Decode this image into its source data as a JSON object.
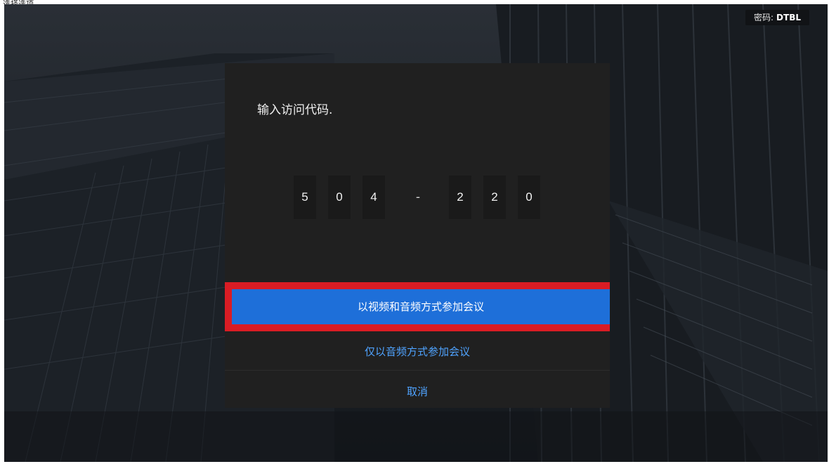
{
  "top_caption": "选择选项",
  "password_badge": {
    "label": "密码:",
    "value": "DTBL"
  },
  "dialog": {
    "title": "输入访问代码.",
    "access_code": [
      "5",
      "0",
      "4",
      "-",
      "2",
      "2",
      "0"
    ],
    "buttons": {
      "join_video_audio": "以视频和音频方式参加会议",
      "join_audio_only": "仅以音频方式参加会议",
      "cancel": "取消"
    }
  },
  "colors": {
    "dialog_background": "#202020",
    "primary_button": "#1e6fd9",
    "link_text": "#4fa3ff",
    "highlight_border": "#d91c24"
  }
}
